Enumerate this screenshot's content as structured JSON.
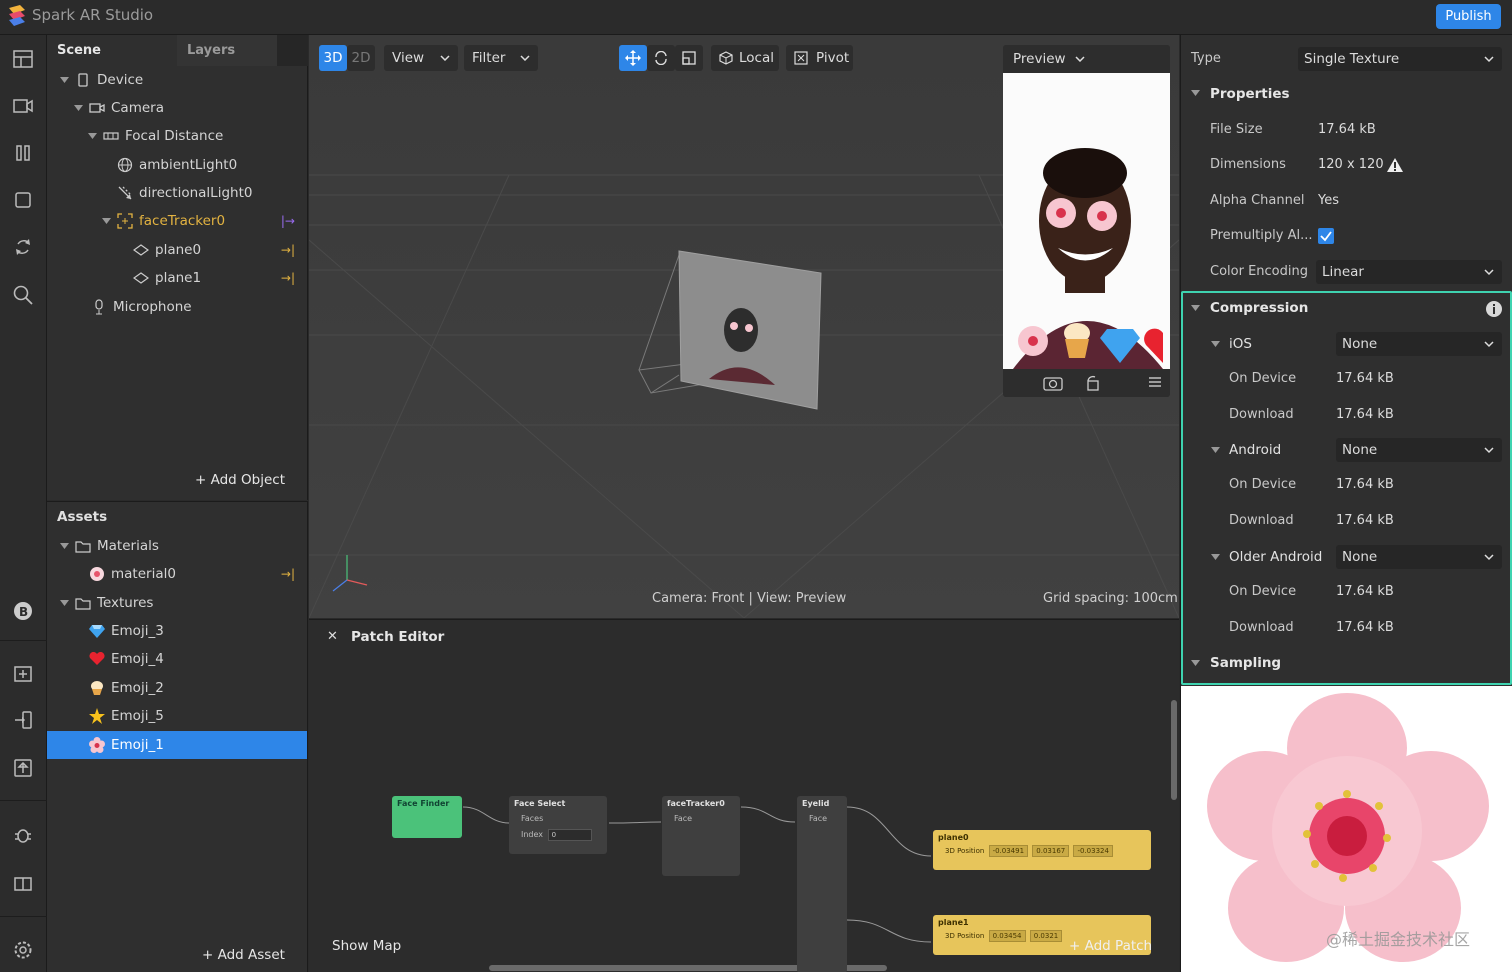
{
  "app": {
    "title": "Spark AR Studio",
    "publish_label": "Publish"
  },
  "scene_panel": {
    "tabs": [
      "Scene",
      "Layers"
    ],
    "tree": [
      {
        "label": "Device",
        "icon": "phone-icon"
      },
      {
        "label": "Camera",
        "icon": "camera-icon"
      },
      {
        "label": "Focal Distance",
        "icon": "focal-distance-icon"
      },
      {
        "label": "ambientLight0",
        "icon": "ambient-light-icon"
      },
      {
        "label": "directionalLight0",
        "icon": "directional-light-icon"
      },
      {
        "label": "faceTracker0",
        "icon": "face-tracker-icon"
      },
      {
        "label": "plane0",
        "icon": "plane-icon"
      },
      {
        "label": "plane1",
        "icon": "plane-icon"
      },
      {
        "label": "Microphone",
        "icon": "microphone-icon"
      }
    ],
    "add_object_label": "Add Object"
  },
  "assets_panel": {
    "title": "Assets",
    "tree": [
      {
        "label": "Materials",
        "icon": "folder-icon"
      },
      {
        "label": "material0",
        "icon": "material-icon"
      },
      {
        "label": "Textures",
        "icon": "folder-icon"
      },
      {
        "label": "Emoji_3",
        "icon": "gem-emoji-icon"
      },
      {
        "label": "Emoji_4",
        "icon": "heart-emoji-icon"
      },
      {
        "label": "Emoji_2",
        "icon": "cupcake-emoji-icon"
      },
      {
        "label": "Emoji_5",
        "icon": "star-emoji-icon"
      },
      {
        "label": "Emoji_1",
        "icon": "blossom-emoji-icon"
      }
    ],
    "add_asset_label": "Add Asset"
  },
  "viewport": {
    "mode_3d": "3D",
    "mode_2d": "2D",
    "view_label": "View",
    "filter_label": "Filter",
    "local_label": "Local",
    "pivot_label": "Pivot",
    "preview_label": "Preview",
    "status_text": "Camera: Front | View: Preview",
    "grid_text": "Grid spacing: 100cm"
  },
  "patch_editor": {
    "title": "Patch Editor",
    "show_map_label": "Show Map",
    "add_patch_label": "Add Patch",
    "nodes": {
      "face_finder": {
        "title": "Face Finder"
      },
      "face_select": {
        "title": "Face Select",
        "ports": [
          "Faces",
          "Index"
        ],
        "index_value": "0"
      },
      "face_tracker": {
        "title": "faceTracker0",
        "ports": [
          "Face"
        ]
      },
      "eyelid": {
        "title": "Eyelid",
        "ports": [
          "Face"
        ]
      },
      "plane0": {
        "title": "plane0",
        "port": "3D Position",
        "fields": [
          "-0.03491",
          "0.03167",
          "-0.03324"
        ]
      },
      "plane1": {
        "title": "plane1",
        "port": "3D Position",
        "fields": [
          "0.03454",
          "0.0321",
          ""
        ]
      }
    }
  },
  "inspector": {
    "type_label": "Type",
    "type_value": "Single Texture",
    "properties_title": "Properties",
    "properties": [
      {
        "label": "File Size",
        "value": "17.64 kB"
      },
      {
        "label": "Dimensions",
        "value": "120 x 120"
      },
      {
        "label": "Alpha Channel",
        "value": "Yes"
      },
      {
        "label": "Premultiply Al...",
        "value": ""
      },
      {
        "label": "Color Encoding",
        "value": "Linear"
      }
    ],
    "compression_title": "Compression",
    "platforms": [
      {
        "name": "iOS",
        "option": "None",
        "on_device_label": "On Device",
        "on_device": "17.64 kB",
        "download_label": "Download",
        "download": "17.64 kB"
      },
      {
        "name": "Android",
        "option": "None",
        "on_device_label": "On Device",
        "on_device": "17.64 kB",
        "download_label": "Download",
        "download": "17.64 kB"
      },
      {
        "name": "Older Android",
        "option": "None",
        "on_device_label": "On Device",
        "on_device": "17.64 kB",
        "download_label": "Download",
        "download": "17.64 kB"
      }
    ],
    "sampling_title": "Sampling",
    "watermark": "@稀土掘金技术社区"
  },
  "colors": {
    "accent": "#2e86e8",
    "highlight": "#3fd3b0",
    "pin": "#e3b341"
  }
}
